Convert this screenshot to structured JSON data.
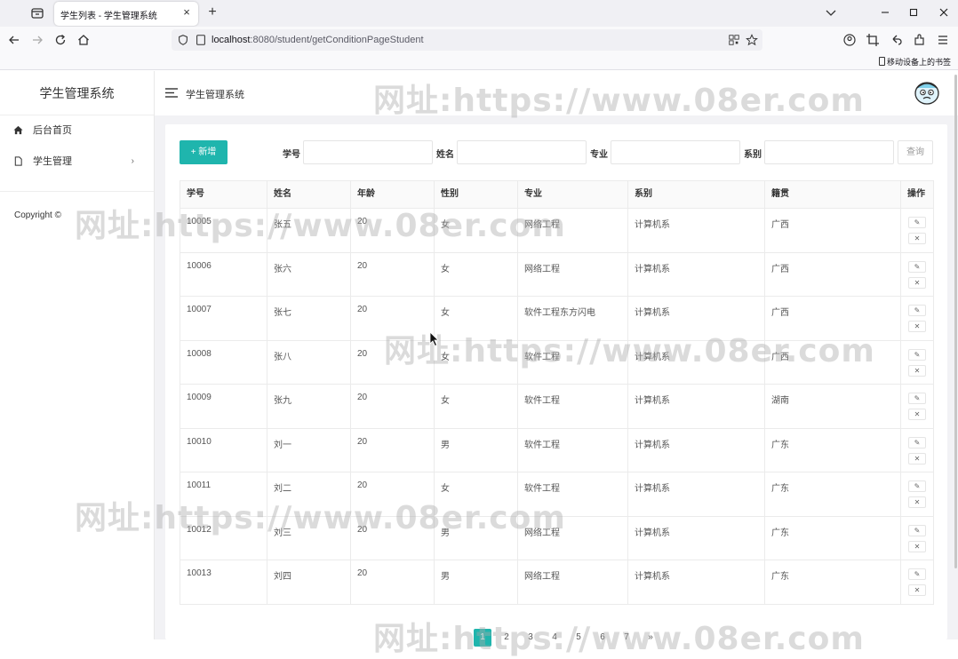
{
  "browser": {
    "tab_title": "学生列表 - 学生管理系统",
    "url_host": "localhost",
    "url_rest": ":8080/student/getConditionPageStudent",
    "bookmark_item": "移动设备上的书签"
  },
  "sidebar": {
    "logo": "学生管理系统",
    "items": [
      {
        "label": "后台首页",
        "icon": "home-icon"
      },
      {
        "label": "学生管理",
        "icon": "document-icon",
        "arrow": "›"
      }
    ],
    "copyright": "Copyright ©"
  },
  "header": {
    "title": "学生管理系统"
  },
  "toolbar": {
    "add_label": "+ 新增",
    "query_label": "查询",
    "filters": [
      {
        "label": "学号",
        "value": ""
      },
      {
        "label": "姓名",
        "value": ""
      },
      {
        "label": "专业",
        "value": ""
      },
      {
        "label": "系别",
        "value": ""
      }
    ]
  },
  "table": {
    "columns": [
      "学号",
      "姓名",
      "年龄",
      "性别",
      "专业",
      "系别",
      "籍贯",
      "操作"
    ],
    "rows": [
      [
        "10005",
        "张五",
        "20",
        "女",
        "网络工程",
        "计算机系",
        "广西"
      ],
      [
        "10006",
        "张六",
        "20",
        "女",
        "网络工程",
        "计算机系",
        "广西"
      ],
      [
        "10007",
        "张七",
        "20",
        "女",
        "软件工程东方闪电",
        "计算机系",
        "广西"
      ],
      [
        "10008",
        "张八",
        "20",
        "女",
        "软件工程",
        "计算机系",
        "广西"
      ],
      [
        "10009",
        "张九",
        "20",
        "女",
        "软件工程",
        "计算机系",
        "湖南"
      ],
      [
        "10010",
        "刘一",
        "20",
        "男",
        "软件工程",
        "计算机系",
        "广东"
      ],
      [
        "10011",
        "刘二",
        "20",
        "女",
        "软件工程",
        "计算机系",
        "广东"
      ],
      [
        "10012",
        "刘三",
        "20",
        "男",
        "网络工程",
        "计算机系",
        "广东"
      ],
      [
        "10013",
        "刘四",
        "20",
        "男",
        "网络工程",
        "计算机系",
        "广东"
      ]
    ],
    "edit_glyph": "✎",
    "delete_glyph": "✕"
  },
  "pagination": {
    "pages": [
      "1",
      "2",
      "3",
      "4",
      "5",
      "6",
      "7",
      "»"
    ],
    "active": "1"
  },
  "watermark": "网址:https://www.08er.com",
  "colors": {
    "accent": "#1fb5ad",
    "content_bg": "#f2f2f5"
  }
}
